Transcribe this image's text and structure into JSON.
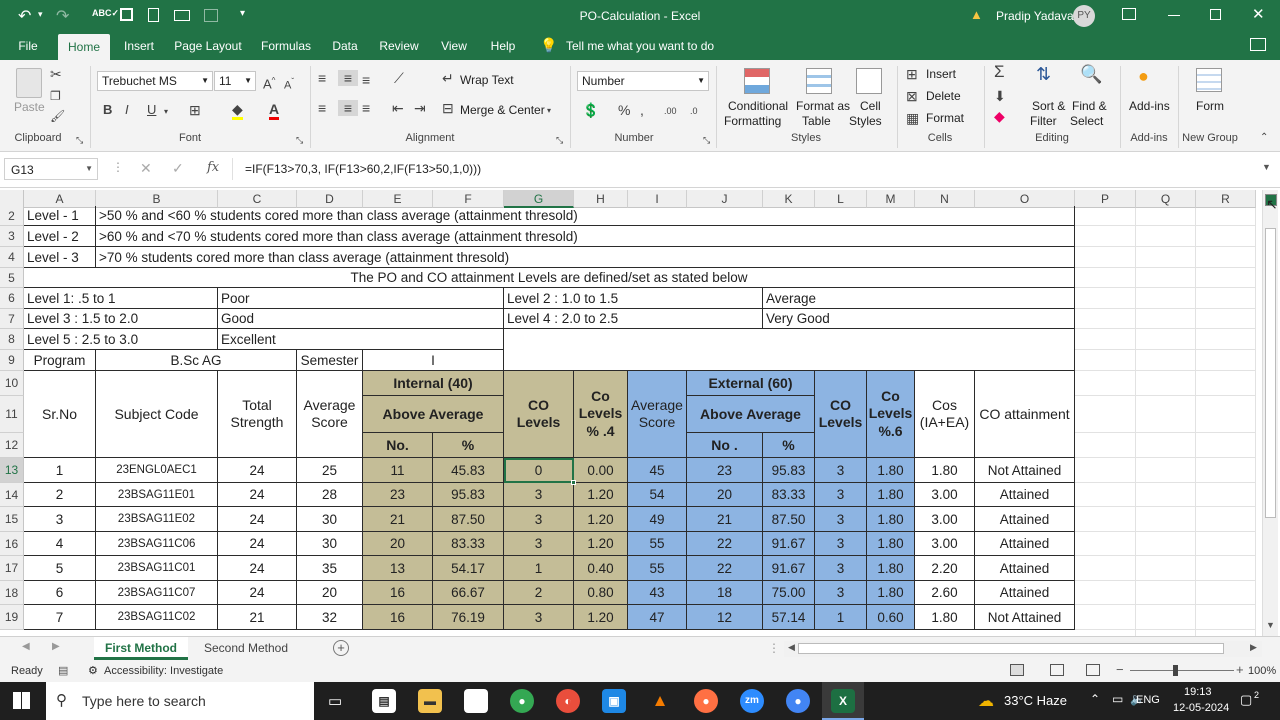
{
  "window": {
    "title": "PO-Calculation  -  Excel",
    "user": "Pradip Yadava",
    "user_initials": "PY"
  },
  "tabs": [
    "File",
    "Home",
    "Insert",
    "Page Layout",
    "Formulas",
    "Data",
    "Review",
    "View",
    "Help"
  ],
  "tell_me": "Tell me what you want to do",
  "ribbon": {
    "font_name": "Trebuchet MS",
    "font_size": "11",
    "number_format": "Number",
    "wrap_text": "Wrap Text",
    "merge_center": "Merge & Center",
    "paste": "Paste",
    "conditional_formatting": [
      "Conditional",
      "Formatting"
    ],
    "format_as_table": [
      "Format as",
      "Table"
    ],
    "cell_styles": [
      "Cell",
      "Styles"
    ],
    "insert": "Insert",
    "delete": "Delete",
    "format": "Format",
    "sort_filter": [
      "Sort &",
      "Filter"
    ],
    "find_select": [
      "Find &",
      "Select"
    ],
    "addins": "Add-ins",
    "form": "Form",
    "groups": [
      "Clipboard",
      "Font",
      "Alignment",
      "Number",
      "Styles",
      "Cells",
      "Editing",
      "Add-ins",
      "New Group"
    ]
  },
  "formula_bar": {
    "name_box": "G13",
    "formula": "=IF(F13>70,3, IF(F13>60,2,IF(F13>50,1,0)))"
  },
  "columns": [
    "A",
    "B",
    "C",
    "D",
    "E",
    "F",
    "G",
    "H",
    "I",
    "J",
    "K",
    "L",
    "M",
    "N",
    "O",
    "P",
    "Q",
    "R"
  ],
  "rows": [
    "2",
    "3",
    "4",
    "5",
    "6",
    "7",
    "8",
    "9",
    "10",
    "11",
    "12",
    "13",
    "14",
    "15",
    "16",
    "17",
    "18",
    "19"
  ],
  "sheet": {
    "level1": "Level  - 1",
    "level1_desc": ">50 % and <60 % students cored more than class average (attainment thresold)",
    "level2": "Level  - 2",
    "level2_desc": ">60 % and <70 % students cored more than class average (attainment thresold)",
    "level3": "Level  - 3",
    "level3_desc": ">70 % students cored more than class average (attainment thresold)",
    "banner": "The PO and CO attainment Levels are defined/set as stated below",
    "l1": "Level 1: .5 to 1",
    "l1_val": "Poor",
    "l2": "Level 2 : 1.0 to 1.5",
    "l2_val": "Average",
    "l3": "Level 3 : 1.5 to 2.0",
    "l3_val": "Good",
    "l4": "Level 4 : 2.0 to 2.5",
    "l4_val": "Very Good",
    "l5": "Level 5 : 2.5 to 3.0",
    "l5_val": "Excellent",
    "program_label": "Program",
    "program": "B.Sc AG",
    "semester_label": "Semester",
    "semester": "I",
    "h_srno": "Sr.No",
    "h_subject": "Subject Code",
    "h_total": [
      "Total",
      "Strength"
    ],
    "h_avg": [
      "Average",
      "Score"
    ],
    "h_internal": "Internal (40)",
    "h_above": "Above Average",
    "h_no": "No.",
    "h_pct": "%",
    "h_co_levels": [
      "CO",
      "Levels"
    ],
    "h_co_levels4": [
      "Co",
      "Levels",
      "% .4"
    ],
    "h_avg_score": [
      "Average",
      "Score"
    ],
    "h_external": "External (60)",
    "h_above2": "Above Average",
    "h_no2": "No .",
    "h_pct2": "%",
    "h_co_levels2": [
      "CO",
      "Levels"
    ],
    "h_co_levels6": [
      "Co",
      "Levels",
      "%.6"
    ],
    "h_cos": [
      "Cos",
      "(IA+EA)"
    ],
    "h_attain": "CO attainment",
    "data_rows": [
      [
        "1",
        "23ENGL0AEC1",
        "24",
        "25",
        "11",
        "45.83",
        "0",
        "0.00",
        "45",
        "23",
        "95.83",
        "3",
        "1.80",
        "1.80",
        "Not Attained"
      ],
      [
        "2",
        "23BSAG11E01",
        "24",
        "28",
        "23",
        "95.83",
        "3",
        "1.20",
        "54",
        "20",
        "83.33",
        "3",
        "1.80",
        "3.00",
        "Attained"
      ],
      [
        "3",
        "23BSAG11E02",
        "24",
        "30",
        "21",
        "87.50",
        "3",
        "1.20",
        "49",
        "21",
        "87.50",
        "3",
        "1.80",
        "3.00",
        "Attained"
      ],
      [
        "4",
        "23BSAG11C06",
        "24",
        "30",
        "20",
        "83.33",
        "3",
        "1.20",
        "55",
        "22",
        "91.67",
        "3",
        "1.80",
        "3.00",
        "Attained"
      ],
      [
        "5",
        "23BSAG11C01",
        "24",
        "35",
        "13",
        "54.17",
        "1",
        "0.40",
        "55",
        "22",
        "91.67",
        "3",
        "1.80",
        "2.20",
        "Attained"
      ],
      [
        "6",
        "23BSAG11C07",
        "24",
        "20",
        "16",
        "66.67",
        "2",
        "0.80",
        "43",
        "18",
        "75.00",
        "3",
        "1.80",
        "2.60",
        "Attained"
      ],
      [
        "7",
        "23BSAG11C02",
        "21",
        "32",
        "16",
        "76.19",
        "3",
        "1.20",
        "47",
        "12",
        "57.14",
        "1",
        "0.60",
        "1.80",
        "Not Attained"
      ]
    ]
  },
  "sheet_tabs": [
    "First Method",
    "Second Method"
  ],
  "status": {
    "ready": "Ready",
    "accessibility": "Accessibility: Investigate",
    "zoom": "100%"
  },
  "taskbar": {
    "search": "Type here to search",
    "weather": "33°C  Haze",
    "lang": "ENG",
    "time": "19:13",
    "date": "12-05-2024",
    "notif": "2"
  },
  "colors": {
    "excel_green": "#217346",
    "olive": "#c4bd97",
    "blue": "#8db4e2"
  }
}
